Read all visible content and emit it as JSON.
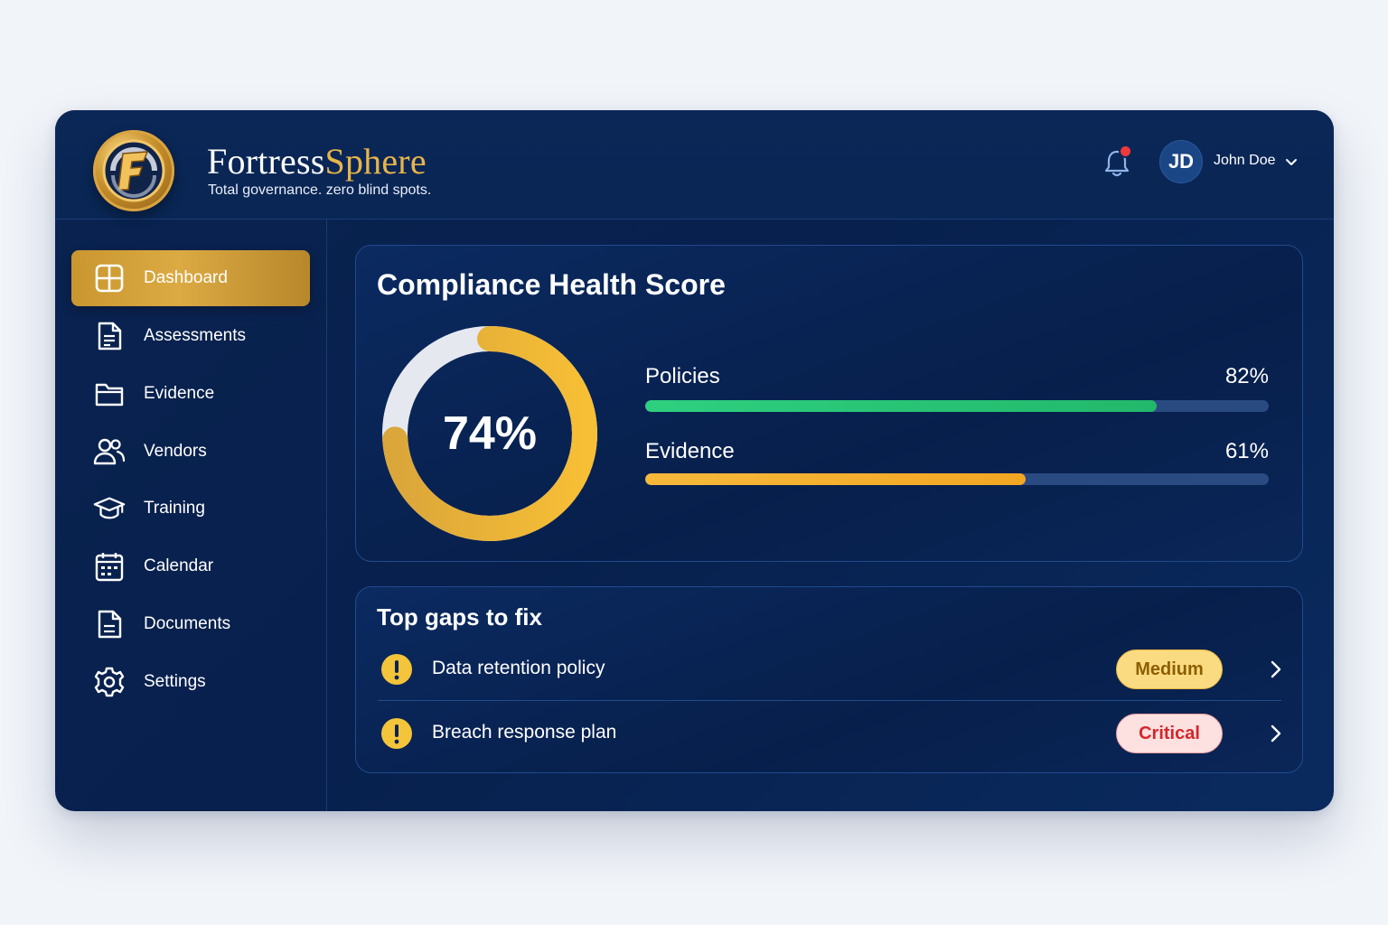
{
  "app": {
    "brand_primary": "Fortress",
    "brand_accent": "Sphere",
    "tagline": "Total governance. zero blind spots."
  },
  "header": {
    "notifications_icon": "bell-icon",
    "has_unread": true,
    "user": {
      "initials": "JD",
      "name": "John Doe"
    }
  },
  "sidebar": {
    "items": [
      {
        "label": "Dashboard",
        "icon": "dashboard-grid-icon",
        "active": true
      },
      {
        "label": "Assessments",
        "icon": "document-icon",
        "active": false
      },
      {
        "label": "Evidence",
        "icon": "folder-icon",
        "active": false
      },
      {
        "label": "Vendors",
        "icon": "users-icon",
        "active": false
      },
      {
        "label": "Training",
        "icon": "graduation-cap-icon",
        "active": false
      },
      {
        "label": "Calendar",
        "icon": "calendar-icon",
        "active": false
      },
      {
        "label": "Documents",
        "icon": "file-text-icon",
        "active": false
      },
      {
        "label": "Settings",
        "icon": "gear-icon",
        "active": false
      }
    ]
  },
  "score": {
    "title": "Compliance Health Score",
    "overall": 74,
    "overall_label": "74%",
    "metrics": [
      {
        "label": "Policies",
        "value": 82,
        "value_label": "82%",
        "color": "#2ed07f"
      },
      {
        "label": "Evidence",
        "value": 61,
        "value_label": "61%",
        "color": "#f7b93a"
      }
    ]
  },
  "gaps": {
    "title": "Top gaps to fix",
    "items": [
      {
        "label": "Data retention policy",
        "severity": "Medium"
      },
      {
        "label": "Breach response plan",
        "severity": "Critical"
      }
    ]
  },
  "colors": {
    "accent_gold": "#dcaa43",
    "background": "#07204d",
    "medium": "#fbdb82",
    "critical": "#d3262a"
  }
}
